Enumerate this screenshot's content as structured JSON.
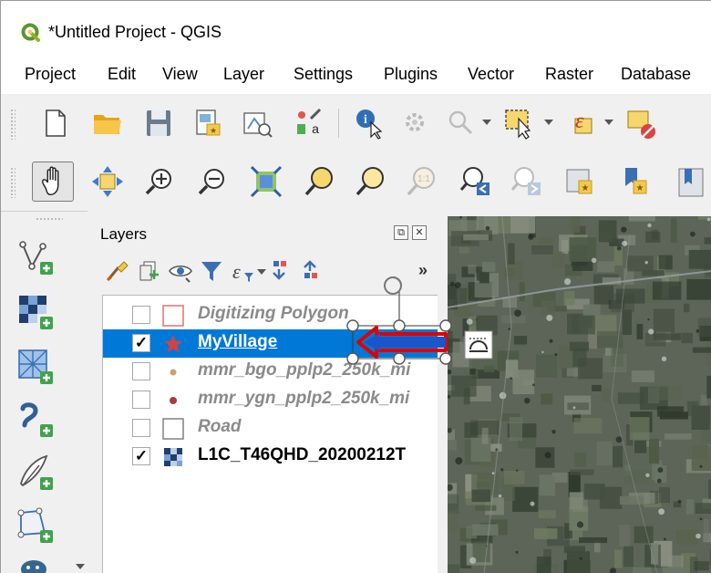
{
  "window": {
    "title": "*Untitled Project - QGIS",
    "app_icon": "qgis-logo-icon"
  },
  "menu": {
    "items": [
      "Project",
      "Edit",
      "View",
      "Layer",
      "Settings",
      "Plugins",
      "Vector",
      "Raster",
      "Database"
    ]
  },
  "toolbar_file": {
    "tools": [
      "new-project-icon",
      "open-project-icon",
      "save-project-icon",
      "print-layout-icon",
      "layout-manager-icon",
      "style-manager-icon",
      "identify-features-icon",
      "run-action-icon",
      "select-features-icon",
      "select-by-expression-icon",
      "deselect-features-icon"
    ]
  },
  "toolbar_map_nav": {
    "tools": [
      "pan-map-icon",
      "pan-to-selection-icon",
      "zoom-in-icon",
      "zoom-out-icon",
      "zoom-full-icon",
      "zoom-to-selection-icon",
      "zoom-to-layer-icon",
      "zoom-native-resolution-icon",
      "zoom-last-icon",
      "zoom-next-icon",
      "new-map-view-icon",
      "new-bookmark-icon",
      "show-bookmarks-icon"
    ],
    "selected_tool": "pan-map-icon"
  },
  "left_toolbar": {
    "tools": [
      "add-vector-layer-icon",
      "add-raster-layer-icon",
      "add-mesh-layer-icon",
      "add-delimited-text-icon",
      "add-geopackage-layer-icon",
      "add-spatialite-layer-icon",
      "add-postgis-layer-icon"
    ]
  },
  "layers_panel": {
    "title": "Layers",
    "float_button": "⧉",
    "close_button": "✕",
    "more_button": "»",
    "tools": [
      "open-layer-styling-icon",
      "add-group-icon",
      "manage-map-themes-icon",
      "filter-legend-icon",
      "filter-by-expression-icon",
      "expand-all-icon",
      "collapse-all-icon"
    ],
    "layers": [
      {
        "name": "Digitizing Polygon",
        "checked": false,
        "check_mark": "",
        "symbol": "polygon-empty-icon",
        "style": "italic"
      },
      {
        "name": "MyVillage",
        "checked": true,
        "check_mark": "✓",
        "symbol": "star-point-icon",
        "style": "selected"
      },
      {
        "name": "mmr_bgo_pplp2_250k_mi",
        "checked": false,
        "check_mark": "",
        "symbol": "point-tan-icon",
        "style": "italic"
      },
      {
        "name": "mmr_ygn_pplp2_250k_mi",
        "checked": false,
        "check_mark": "",
        "symbol": "point-red-icon",
        "style": "italic"
      },
      {
        "name": "Road",
        "checked": false,
        "check_mark": "",
        "symbol": "polygon-empty-icon",
        "style": "italic"
      },
      {
        "name": "L1C_T46QHD_20200212T",
        "checked": true,
        "check_mark": "✓",
        "symbol": "raster-layer-icon",
        "style": "bold"
      }
    ]
  },
  "colors": {
    "selection": "#0078d7",
    "annotation_red": "#e00000",
    "disabled_text": "#8a8a8a"
  }
}
